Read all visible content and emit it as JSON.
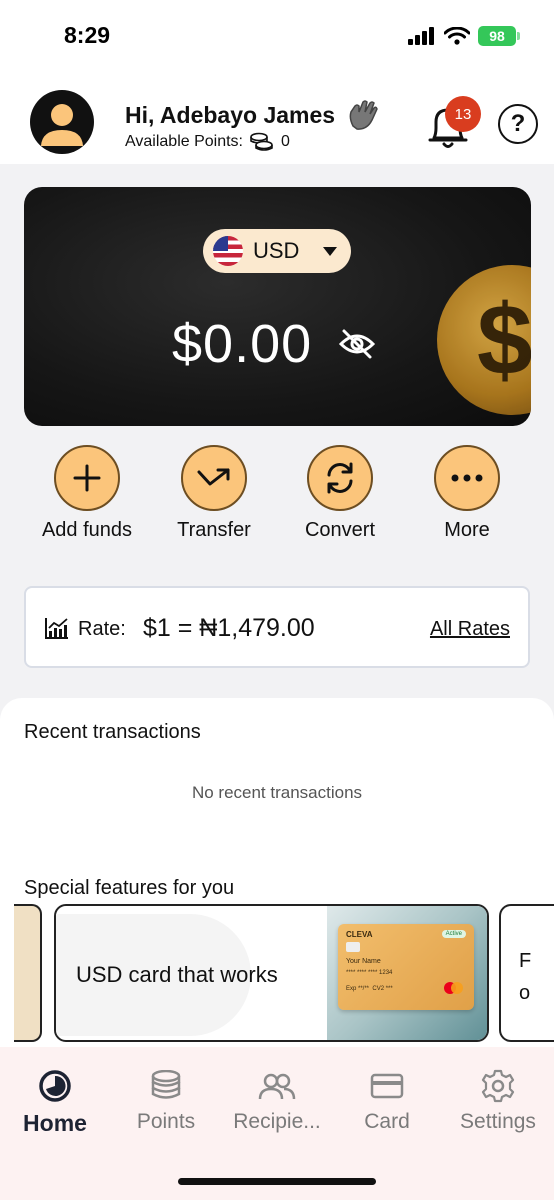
{
  "status_bar": {
    "time": "8:29",
    "battery": "98"
  },
  "header": {
    "greeting": "Hi, Adebayo James",
    "points_label": "Available Points:",
    "points_value": "0",
    "notification_count": "13",
    "help_symbol": "?"
  },
  "balance": {
    "currency": "USD",
    "amount": "$0.00",
    "coin_symbol": "$"
  },
  "actions": [
    {
      "label": "Add funds",
      "icon": "plus-icon"
    },
    {
      "label": "Transfer",
      "icon": "transfer-arrow-icon"
    },
    {
      "label": "Convert",
      "icon": "convert-icon"
    },
    {
      "label": "More",
      "icon": "more-dots-icon"
    }
  ],
  "rate": {
    "label": "Rate:",
    "value": "$1 = ₦1,479.00",
    "link": "All Rates"
  },
  "recent": {
    "title": "Recent transactions",
    "empty": "No recent transactions"
  },
  "special": {
    "title": "Special features for you",
    "promo_text": "USD card that works",
    "card": {
      "brand": "CLEVA",
      "status": "Active",
      "name": "Your Name",
      "number": "**** **** **** 1234",
      "exp": "Exp **/**",
      "cvv": "CV2 ***"
    },
    "next_line1": "F",
    "next_line2": "o"
  },
  "tabs": [
    {
      "label": "Home",
      "icon": "home-icon",
      "active": true
    },
    {
      "label": "Points",
      "icon": "coins-icon",
      "active": false
    },
    {
      "label": "Recipie...",
      "icon": "recipients-icon",
      "active": false
    },
    {
      "label": "Card",
      "icon": "card-icon",
      "active": false
    },
    {
      "label": "Settings",
      "icon": "gear-icon",
      "active": false
    }
  ],
  "colors": {
    "accent": "#fbc57b",
    "badge": "#d93d1f",
    "card_bg": "#161616",
    "tab_active": "#1d2333"
  }
}
